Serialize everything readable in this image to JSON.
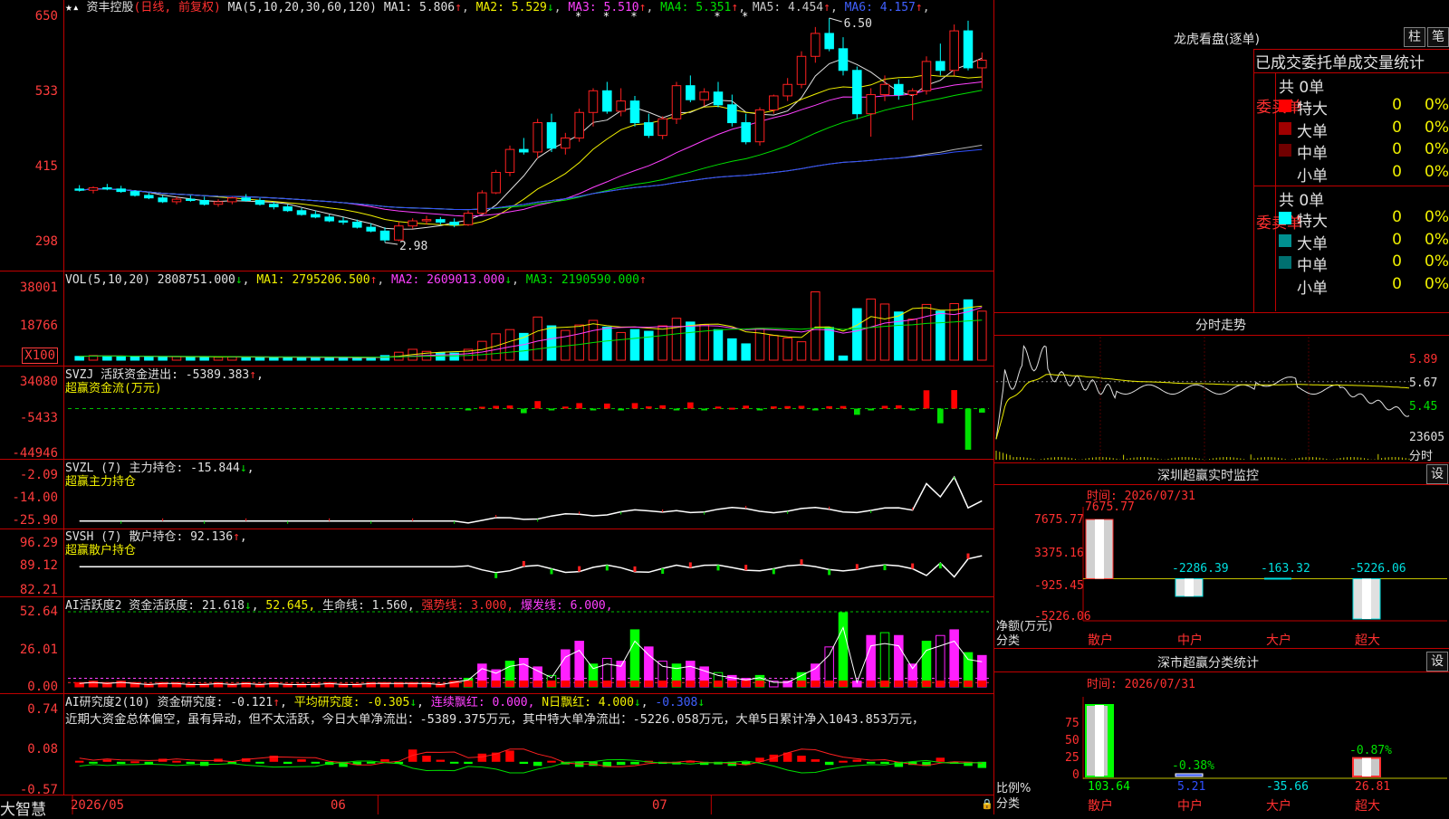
{
  "main": {
    "title": "资丰控股",
    "subtitle": "(日线, 前复权)",
    "ma_spec": "MA(5,10,20,30,60,120)",
    "ma_values": [
      {
        "label": "MA1: 5.806",
        "arrow": "↑",
        "color": "#e0e0e0"
      },
      {
        "label": "MA2: 5.529",
        "arrow": "↓",
        "color": "#f0f000"
      },
      {
        "label": "MA3: 5.510",
        "arrow": "↑",
        "color": "#ff40ff"
      },
      {
        "label": "MA4: 5.351",
        "arrow": "↑",
        "color": "#00e000"
      },
      {
        "label": "MA5: 4.454",
        "arrow": "↑",
        "color": "#c8c8c8"
      },
      {
        "label": "MA6: 4.157",
        "arrow": "↑",
        "color": "#4060ff"
      }
    ],
    "y_ticks": [
      "650",
      "533",
      "415",
      "298"
    ],
    "high_label": "6.50",
    "low_label": "2.98",
    "x_ticks": [
      "2026/05",
      "06",
      "07"
    ],
    "brand": "大智慧"
  },
  "vol": {
    "spec": "VOL(5,10,20)",
    "value": "2808751.000",
    "value_arrow": "↓",
    "ma": [
      {
        "label": "MA1: 2795206.500",
        "arrow": "↑",
        "color": "#f0f000"
      },
      {
        "label": "MA2: 2609013.000",
        "arrow": "↓",
        "color": "#ff40ff"
      },
      {
        "label": "MA3: 2190590.000",
        "arrow": "↑",
        "color": "#00e000"
      }
    ],
    "y_ticks": [
      "38001",
      "18766"
    ],
    "unit": "X100"
  },
  "svzj": {
    "line1": "SVZJ  活跃资金进出: -5389.383",
    "line1_arrow": "↑",
    "line2": "超赢资金流(万元)",
    "y_ticks": [
      "34080",
      "-5433",
      "-44946"
    ]
  },
  "svzl": {
    "line1": "SVZL (7) 主力持仓: -15.844",
    "line1_arrow": "↓",
    "line2": "超赢主力持仓",
    "y_ticks": [
      "-2.09",
      "-14.00",
      "-25.90"
    ]
  },
  "svsh": {
    "line1": "SVSH (7) 散户持仓: 92.136",
    "line1_arrow": "↑",
    "line2": "超赢散户持仓",
    "y_ticks": [
      "96.29",
      "89.12",
      "82.21"
    ]
  },
  "ai1": {
    "prefix": "AI活跃度2 资金活跃度: 21.618",
    "prefix_arrow": "↓",
    "v2": "52.645,",
    "v3": "生命线: 1.560,",
    "v4": "强势线: 3.000,",
    "v5": "爆发线: 6.000,",
    "y_ticks": [
      "52.64",
      "26.01",
      "0.00"
    ]
  },
  "ai2": {
    "prefix": "AI研究度2(10) 资金研究度: -0.121",
    "prefix_arrow": "↑",
    "v2": "平均研究度: -0.305",
    "v2_arrow": "↓",
    "v3": "连续飘红: 0.000,",
    "v4": "N日飘红: 4.000",
    "v4_arrow": "↓",
    "v5": "-0.308",
    "v5_arrow": "↓",
    "comment": "近期大资金总体偏空，虽有异动，但不太活跃，今日大单净流出：-5389.375万元，其中特大单净流出：-5226.058万元，大单5日累计净入1043.853万元，",
    "y_ticks": [
      "0.74",
      "0.08",
      "-0.57"
    ]
  },
  "right": {
    "lhb_title": "龙虎看盘(逐单)",
    "btn_zhu": "柱",
    "btn_bi": "笔",
    "stat_title": "已成交委托单成交量统计",
    "buy": {
      "side_label": "委买单",
      "total": "共 0单",
      "rows": [
        {
          "name": "特大",
          "v": "0",
          "p": "0%",
          "color": "#ff0000"
        },
        {
          "name": "大单",
          "v": "0",
          "p": "0%",
          "color": "#a00000"
        },
        {
          "name": "中单",
          "v": "0",
          "p": "0%",
          "color": "#700000"
        },
        {
          "name": "小单",
          "v": "0",
          "p": "0%",
          "color": ""
        }
      ]
    },
    "sell": {
      "side_label": "委卖单",
      "total": "共 0单",
      "rows": [
        {
          "name": "特大",
          "v": "0",
          "p": "0%",
          "color": "#00ffff"
        },
        {
          "name": "大单",
          "v": "0",
          "p": "0%",
          "color": "#009090"
        },
        {
          "name": "中单",
          "v": "0",
          "p": "0%",
          "color": "#007070"
        },
        {
          "name": "小单",
          "v": "0",
          "p": "0%",
          "color": ""
        }
      ]
    },
    "fenshi": {
      "title": "分时走势",
      "ticks": [
        "5.89",
        "5.67",
        "5.45"
      ],
      "vol_label": "23605",
      "fen_label": "分时"
    },
    "sz_monitor": {
      "title": "深圳超赢实时监控",
      "set": "设",
      "time": "时间: 2026/07/31",
      "y_ticks": [
        "7675.77",
        "3375.16",
        "-925.45",
        "-5226.06"
      ],
      "y_label": "净额(万元)",
      "x_label": "分类",
      "categories": [
        "散户",
        "中户",
        "大户",
        "超大"
      ],
      "values": [
        "7675.77",
        "-2286.39",
        "-163.32",
        "-5226.06"
      ]
    },
    "sz_stat": {
      "title": "深市超赢分类统计",
      "set": "设",
      "time": "时间: 2026/07/31",
      "y_ticks": [
        "75",
        "50",
        "25",
        "0"
      ],
      "y_label": "比例%",
      "x_label": "分类",
      "categories": [
        "散户",
        "中户",
        "大户",
        "超大"
      ],
      "values": [
        "103.64",
        "5.21",
        "-35.66",
        "26.81"
      ],
      "pct": [
        "-0.38%",
        "-0.87%"
      ]
    }
  },
  "chart_data": [
    {
      "type": "candlestick",
      "title": "资丰控股 (日线, 前复权)",
      "ylim": [
        2.98,
        6.5
      ],
      "x_ticks": [
        "2026/05",
        "06",
        "07"
      ],
      "candles": [
        [
          3.82,
          3.88,
          3.78,
          3.8
        ],
        [
          3.8,
          3.86,
          3.75,
          3.84
        ],
        [
          3.84,
          3.9,
          3.8,
          3.82
        ],
        [
          3.82,
          3.87,
          3.76,
          3.78
        ],
        [
          3.78,
          3.8,
          3.7,
          3.72
        ],
        [
          3.72,
          3.76,
          3.66,
          3.68
        ],
        [
          3.68,
          3.72,
          3.6,
          3.62
        ],
        [
          3.62,
          3.7,
          3.58,
          3.66
        ],
        [
          3.66,
          3.72,
          3.62,
          3.64
        ],
        [
          3.64,
          3.7,
          3.56,
          3.58
        ],
        [
          3.58,
          3.66,
          3.54,
          3.62
        ],
        [
          3.62,
          3.7,
          3.58,
          3.68
        ],
        [
          3.68,
          3.74,
          3.62,
          3.64
        ],
        [
          3.64,
          3.68,
          3.56,
          3.58
        ],
        [
          3.58,
          3.62,
          3.5,
          3.54
        ],
        [
          3.54,
          3.58,
          3.46,
          3.48
        ],
        [
          3.48,
          3.52,
          3.4,
          3.42
        ],
        [
          3.42,
          3.48,
          3.36,
          3.38
        ],
        [
          3.38,
          3.42,
          3.3,
          3.32
        ],
        [
          3.32,
          3.38,
          3.26,
          3.3
        ],
        [
          3.3,
          3.34,
          3.2,
          3.22
        ],
        [
          3.22,
          3.28,
          3.14,
          3.16
        ],
        [
          3.16,
          3.22,
          2.98,
          3.02
        ],
        [
          3.02,
          3.3,
          3.0,
          3.24
        ],
        [
          3.24,
          3.36,
          3.2,
          3.32
        ],
        [
          3.32,
          3.4,
          3.26,
          3.34
        ],
        [
          3.34,
          3.38,
          3.26,
          3.3
        ],
        [
          3.3,
          3.36,
          3.22,
          3.26
        ],
        [
          3.26,
          3.48,
          3.24,
          3.44
        ],
        [
          3.44,
          3.8,
          3.42,
          3.76
        ],
        [
          3.76,
          4.12,
          3.74,
          4.08
        ],
        [
          4.08,
          4.5,
          4.02,
          4.44
        ],
        [
          4.44,
          4.62,
          4.36,
          4.4
        ],
        [
          4.4,
          4.92,
          4.3,
          4.86
        ],
        [
          4.86,
          5.0,
          4.4,
          4.46
        ],
        [
          4.46,
          4.7,
          4.36,
          4.62
        ],
        [
          4.62,
          5.08,
          4.56,
          5.02
        ],
        [
          5.02,
          5.4,
          4.8,
          5.36
        ],
        [
          5.36,
          5.5,
          5.0,
          5.04
        ],
        [
          5.04,
          5.4,
          4.96,
          5.2
        ],
        [
          5.2,
          5.28,
          4.8,
          4.86
        ],
        [
          4.86,
          5.0,
          4.62,
          4.66
        ],
        [
          4.66,
          4.96,
          4.6,
          4.92
        ],
        [
          4.92,
          5.5,
          4.84,
          5.44
        ],
        [
          5.44,
          5.6,
          5.18,
          5.22
        ],
        [
          5.22,
          5.4,
          5.12,
          5.34
        ],
        [
          5.34,
          5.5,
          5.1,
          5.14
        ],
        [
          5.14,
          5.3,
          4.8,
          4.86
        ],
        [
          4.86,
          5.0,
          4.52,
          4.56
        ],
        [
          4.56,
          5.1,
          4.5,
          5.06
        ],
        [
          5.06,
          5.3,
          5.0,
          5.28
        ],
        [
          5.28,
          5.56,
          5.2,
          5.46
        ],
        [
          5.46,
          5.98,
          5.4,
          5.9
        ],
        [
          5.9,
          6.36,
          5.8,
          6.26
        ],
        [
          6.26,
          6.5,
          5.98,
          6.02
        ],
        [
          6.02,
          6.2,
          5.6,
          5.68
        ],
        [
          5.68,
          5.74,
          4.92,
          5.0
        ],
        [
          5.0,
          5.4,
          4.64,
          5.3
        ],
        [
          5.3,
          5.6,
          5.2,
          5.46
        ],
        [
          5.46,
          5.54,
          5.22,
          5.3
        ],
        [
          5.3,
          5.4,
          4.9,
          5.36
        ],
        [
          5.36,
          5.9,
          5.3,
          5.82
        ],
        [
          5.82,
          6.1,
          5.6,
          5.68
        ],
        [
          5.68,
          6.4,
          5.6,
          6.3
        ],
        [
          6.3,
          6.46,
          5.68,
          5.72
        ],
        [
          5.72,
          5.96,
          5.4,
          5.84
        ]
      ]
    },
    {
      "type": "bar",
      "title": "VOL(5,10,20)",
      "unit": "X100",
      "ylim": [
        0,
        38001
      ],
      "values": [
        1800,
        2200,
        2000,
        1900,
        1700,
        1600,
        1500,
        1700,
        1600,
        1500,
        1400,
        1600,
        1500,
        1400,
        1300,
        1400,
        1300,
        1300,
        1200,
        1200,
        1100,
        1300,
        2200,
        3800,
        5200,
        4200,
        3600,
        3400,
        5200,
        9000,
        12600,
        14600,
        12800,
        20600,
        16400,
        14200,
        16800,
        19000,
        15800,
        13200,
        14600,
        13800,
        16400,
        20000,
        18200,
        17000,
        14600,
        10200,
        7800,
        15200,
        11800,
        10600,
        8800,
        32600,
        15600,
        2000,
        24600,
        29200,
        26800,
        23000,
        19600,
        26600,
        23400,
        27000,
        28800,
        23400
      ],
      "ma": {
        "MA1": "2795206.500",
        "MA2": "2609013.000",
        "MA3": "2190590.000"
      }
    },
    {
      "type": "bar",
      "title": "SVZJ 活跃资金进出 超赢资金流(万元)",
      "ylim": [
        -44946,
        34080
      ],
      "values": [
        0,
        0,
        0,
        0,
        0,
        0,
        0,
        0,
        0,
        0,
        0,
        0,
        0,
        0,
        0,
        0,
        0,
        0,
        0,
        0,
        0,
        0,
        0,
        0,
        0,
        0,
        0,
        0,
        -300,
        2000,
        3000,
        3400,
        -5000,
        8200,
        -600,
        2200,
        6000,
        -1500,
        5500,
        -800,
        6000,
        2400,
        3600,
        -700,
        6800,
        -1500,
        2200,
        900,
        3200,
        -900,
        2400,
        2700,
        3000,
        -900,
        2600,
        2800,
        -6800,
        -400,
        3000,
        3600,
        -900,
        20000,
        -16000,
        20200,
        -44900,
        -4400
      ],
      "last": "-5389.383"
    },
    {
      "type": "line",
      "title": "SVZL (7) 主力持仓",
      "ylim": [
        -25.9,
        -2.09
      ],
      "last": "-15.844"
    },
    {
      "type": "line",
      "title": "SVSH (7) 散户持仓",
      "ylim": [
        82.21,
        96.29
      ],
      "last": "92.136"
    },
    {
      "type": "bar",
      "title": "AI活跃度2 资金活跃度",
      "ylim": [
        0,
        52.64
      ],
      "values": [
        3,
        4,
        3,
        4,
        3,
        2,
        3,
        3,
        2,
        2,
        3,
        2,
        3,
        2,
        3,
        2,
        2,
        2,
        3,
        2,
        2,
        3,
        3,
        3,
        3,
        3,
        2,
        4,
        6,
        16,
        12,
        18,
        20,
        14,
        8,
        26,
        32,
        16,
        20,
        18,
        40,
        28,
        18,
        16,
        18,
        14,
        10,
        8,
        6,
        8,
        4,
        4,
        10,
        16,
        28,
        52,
        4,
        36,
        38,
        36,
        16,
        32,
        36,
        40,
        24,
        22
      ],
      "last": "21.618"
    },
    {
      "type": "bar",
      "title": "AI研究度2(10) 资金研究度",
      "ylim": [
        -0.57,
        0.74
      ],
      "values": [
        0.02,
        -0.03,
        0.04,
        -0.04,
        0.01,
        -0.05,
        0.06,
        0.02,
        -0.04,
        -0.08,
        0.06,
        -0.03,
        0.07,
        -0.02,
        0.12,
        -0.04,
        0.05,
        -0.03,
        -0.06,
        -0.1,
        -0.06,
        -0.03,
        0.05,
        -0.04,
        0.24,
        0.12,
        0.04,
        -0.02,
        -0.04,
        0.16,
        0.18,
        0.22,
        -0.04,
        -0.08,
        0.02,
        -0.05,
        -0.1,
        -0.08,
        -0.1,
        -0.06,
        -0.05,
        0.02,
        -0.04,
        -0.05,
        0.02,
        -0.06,
        -0.05,
        -0.08,
        -0.06,
        0.08,
        0.14,
        0.18,
        0.12,
        0.05,
        -0.06,
        0.02,
        0.04,
        -0.02,
        -0.04,
        -0.1,
        -0.06,
        -0.08,
        0.08,
        -0.04,
        -0.08,
        -0.12
      ],
      "last": "-0.121"
    },
    {
      "type": "bar",
      "title": "深圳超赢实时监控",
      "categories": [
        "散户",
        "中户",
        "大户",
        "超大"
      ],
      "values": [
        7675.77,
        -2286.39,
        -163.32,
        -5226.06
      ],
      "ylabel": "净额(万元)",
      "xlabel": "分类"
    },
    {
      "type": "bar",
      "title": "深市超赢分类统计",
      "categories": [
        "散户",
        "中户",
        "大户",
        "超大"
      ],
      "values": [
        103.64,
        5.21,
        -35.66,
        26.81
      ],
      "ylabel": "比例%",
      "xlabel": "分类"
    }
  ]
}
